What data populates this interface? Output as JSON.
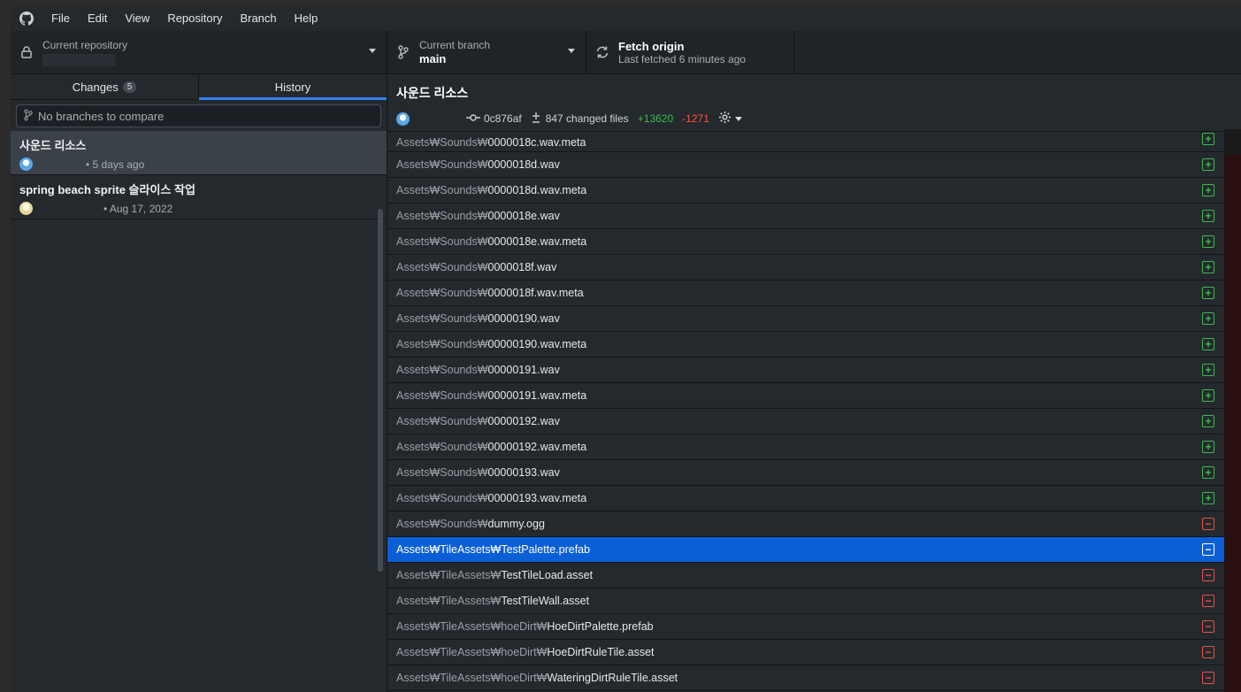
{
  "menubar": {
    "items": [
      "File",
      "Edit",
      "View",
      "Repository",
      "Branch",
      "Help"
    ]
  },
  "toolbar": {
    "repo_label": "Current repository",
    "branch_label": "Current branch",
    "branch_name": "main",
    "fetch_title": "Fetch origin",
    "fetch_sub": "Last fetched 6 minutes ago"
  },
  "sidebar": {
    "tab_changes": "Changes",
    "tab_changes_count": "5",
    "tab_history": "History",
    "compare_placeholder": "No branches to compare",
    "commits": [
      {
        "title": "사운드 리소스",
        "meta": "• 5 days ago"
      },
      {
        "title": "spring beach sprite 슬라이스 작업",
        "meta": "• Aug 17, 2022"
      }
    ]
  },
  "commit": {
    "title": "사운드 리소스",
    "sha": "0c876af",
    "changed": "847 changed files",
    "additions": "+13620",
    "deletions": "-1271"
  },
  "files": [
    {
      "dir": "Assets₩Sounds₩",
      "name": "0000018c.wav.meta",
      "status": "added"
    },
    {
      "dir": "Assets₩Sounds₩",
      "name": "0000018d.wav",
      "status": "added"
    },
    {
      "dir": "Assets₩Sounds₩",
      "name": "0000018d.wav.meta",
      "status": "added"
    },
    {
      "dir": "Assets₩Sounds₩",
      "name": "0000018e.wav",
      "status": "added"
    },
    {
      "dir": "Assets₩Sounds₩",
      "name": "0000018e.wav.meta",
      "status": "added"
    },
    {
      "dir": "Assets₩Sounds₩",
      "name": "0000018f.wav",
      "status": "added"
    },
    {
      "dir": "Assets₩Sounds₩",
      "name": "0000018f.wav.meta",
      "status": "added"
    },
    {
      "dir": "Assets₩Sounds₩",
      "name": "00000190.wav",
      "status": "added"
    },
    {
      "dir": "Assets₩Sounds₩",
      "name": "00000190.wav.meta",
      "status": "added"
    },
    {
      "dir": "Assets₩Sounds₩",
      "name": "00000191.wav",
      "status": "added"
    },
    {
      "dir": "Assets₩Sounds₩",
      "name": "00000191.wav.meta",
      "status": "added"
    },
    {
      "dir": "Assets₩Sounds₩",
      "name": "00000192.wav",
      "status": "added"
    },
    {
      "dir": "Assets₩Sounds₩",
      "name": "00000192.wav.meta",
      "status": "added"
    },
    {
      "dir": "Assets₩Sounds₩",
      "name": "00000193.wav",
      "status": "added"
    },
    {
      "dir": "Assets₩Sounds₩",
      "name": "00000193.wav.meta",
      "status": "added"
    },
    {
      "dir": "Assets₩Sounds₩",
      "name": "dummy.ogg",
      "status": "deleted"
    },
    {
      "dir": "Assets₩TileAssets₩",
      "name": "TestPalette.prefab",
      "status": "deleted",
      "selected": true
    },
    {
      "dir": "Assets₩TileAssets₩",
      "name": "TestTileLoad.asset",
      "status": "deleted"
    },
    {
      "dir": "Assets₩TileAssets₩",
      "name": "TestTileWall.asset",
      "status": "deleted"
    },
    {
      "dir": "Assets₩TileAssets₩hoeDirt₩",
      "name": "HoeDirtPalette.prefab",
      "status": "deleted"
    },
    {
      "dir": "Assets₩TileAssets₩hoeDirt₩",
      "name": "HoeDirtRuleTile.asset",
      "status": "deleted"
    },
    {
      "dir": "Assets₩TileAssets₩hoeDirt₩",
      "name": "WateringDirtRuleTile.asset",
      "status": "deleted"
    }
  ]
}
